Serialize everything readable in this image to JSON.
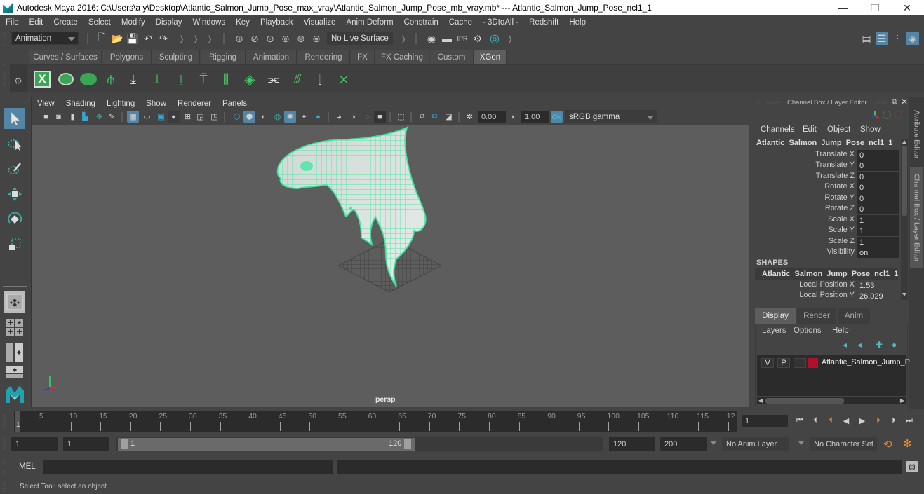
{
  "window": {
    "title": "Autodesk Maya 2016: C:\\Users\\a y\\Desktop\\Atlantic_Salmon_Jump_Pose_max_vray\\Atlantic_Salmon_Jump_Pose_mb_vray.mb*   ---   Atlantic_Salmon_Jump_Pose_ncl1_1",
    "minimize": "—",
    "restore": "❐",
    "close": "✕"
  },
  "menubar": [
    "File",
    "Edit",
    "Create",
    "Select",
    "Modify",
    "Display",
    "Windows",
    "Key",
    "Playback",
    "Visualize",
    "Anim Deform",
    "Constrain",
    "Cache",
    "- 3DtoAll -",
    "Redshift",
    "Help"
  ],
  "statusline": {
    "menuset": "Animation",
    "live_surface": "No Live Surface"
  },
  "shelf": {
    "tabs": [
      "Curves / Surfaces",
      "Polygons",
      "Sculpting",
      "Rigging",
      "Animation",
      "Rendering",
      "FX",
      "FX Caching",
      "Custom",
      "XGen"
    ],
    "active_tab": "XGen",
    "icons": [
      "xgen-editor-icon",
      "xgen-preview-icon",
      "xgen-clear-preview-icon",
      "xgen-add-guides-icon",
      "xgen-sculpt-guides-icon",
      "xgen-add-guide-icon",
      "xgen-guide-select-icon",
      "xgen-lock-guide-icon",
      "xgen-guides-icon",
      "xgen-density-icon",
      "xgen-bend-icon",
      "xgen-length-icon",
      "xgen-width-icon",
      "xgen-delete-guide-icon"
    ]
  },
  "viewport": {
    "menu": [
      "View",
      "Shading",
      "Lighting",
      "Show",
      "Renderer",
      "Panels"
    ],
    "exposure": "0.00",
    "gamma": "1.00",
    "color_space": "sRGB gamma",
    "camera_label": "persp",
    "wire_color": "#40e8a0"
  },
  "channelbox": {
    "header": "Channel Box / Layer Editor",
    "menu": [
      "Channels",
      "Edit",
      "Object",
      "Show"
    ],
    "object_name": "Atlantic_Salmon_Jump_Pose_ncl1_1",
    "channels": [
      {
        "label": "Translate X",
        "value": "0"
      },
      {
        "label": "Translate Y",
        "value": "0"
      },
      {
        "label": "Translate Z",
        "value": "0"
      },
      {
        "label": "Rotate X",
        "value": "0"
      },
      {
        "label": "Rotate Y",
        "value": "0"
      },
      {
        "label": "Rotate Z",
        "value": "0"
      },
      {
        "label": "Scale X",
        "value": "1"
      },
      {
        "label": "Scale Y",
        "value": "1"
      },
      {
        "label": "Scale Z",
        "value": "1"
      },
      {
        "label": "Visibility",
        "value": "on"
      }
    ],
    "shapes_header": "SHAPES",
    "shape_name": "Atlantic_Salmon_Jump_Pose_ncl1_1...",
    "shape_channels": [
      {
        "label": "Local Position X",
        "value": "1.53"
      },
      {
        "label": "Local Position Y",
        "value": "26.029"
      }
    ]
  },
  "side_tabs": [
    "Attribute Editor",
    "Channel Box / Layer Editor"
  ],
  "layer_editor": {
    "tabs": [
      "Display",
      "Render",
      "Anim"
    ],
    "active_tab": "Display",
    "menu": [
      "Layers",
      "Options",
      "Help"
    ],
    "layers": [
      {
        "v": "V",
        "p": "P",
        "color": "#b0102a",
        "name": "Atlantic_Salmon_Jump_P"
      }
    ]
  },
  "timeline": {
    "ticks": [
      "5",
      "10",
      "15",
      "20",
      "25",
      "30",
      "35",
      "40",
      "45",
      "50",
      "55",
      "60",
      "65",
      "70",
      "75",
      "80",
      "85",
      "90",
      "95",
      "100",
      "105",
      "110",
      "115",
      "12"
    ],
    "current_marker": "1",
    "current_frame": "1"
  },
  "range": {
    "start": "1",
    "playback_start": "1",
    "slider_start": "1",
    "slider_end": "120",
    "playback_end": "120",
    "end": "200",
    "anim_layer": "No Anim Layer",
    "character_set": "No Character Set"
  },
  "cmdline": {
    "label": "MEL",
    "input": "",
    "output": ""
  },
  "helpline": {
    "text": "Select Tool: select an object"
  }
}
